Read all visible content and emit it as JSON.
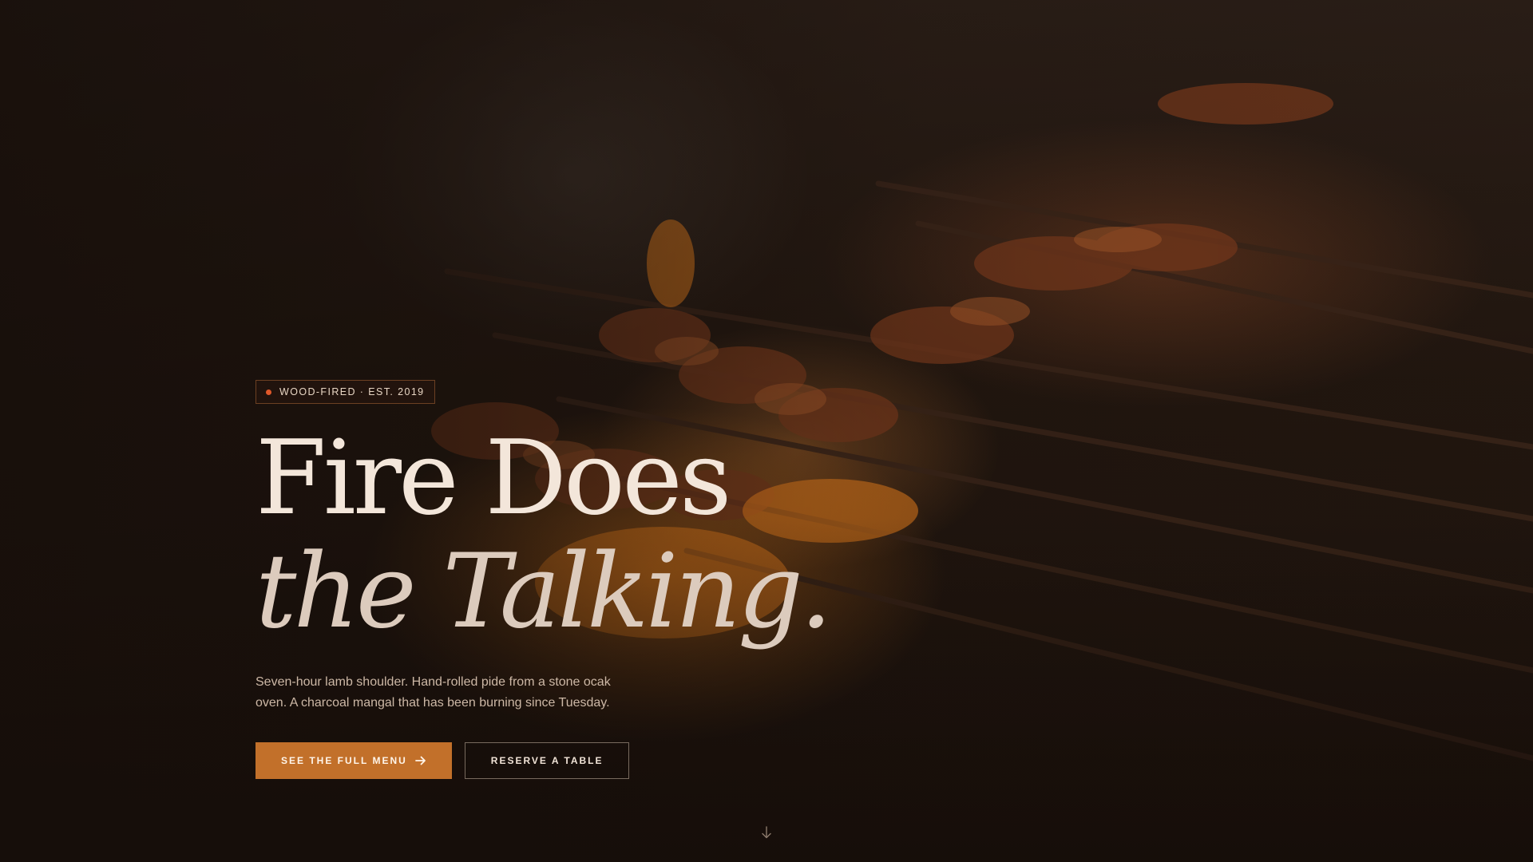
{
  "hero": {
    "badge_text": "WOOD-FIRED · EST. 2019",
    "headline_line1": "Fire Does",
    "headline_line2": "the Talking.",
    "description": "Seven-hour lamb shoulder. Hand-rolled pide from a stone ocak oven. A charcoal mangal that has been burning since Tuesday.",
    "primary_button_label": "SEE THE FULL MENU",
    "secondary_button_label": "RESERVE A TABLE",
    "primary_button_icon": "arrow-right-icon",
    "scroll_icon": "arrow-down-icon"
  },
  "colors": {
    "accent": "#c2702a",
    "badge_dot": "#e0582a",
    "headline": "#f3e6da",
    "background": "#1a120d"
  }
}
